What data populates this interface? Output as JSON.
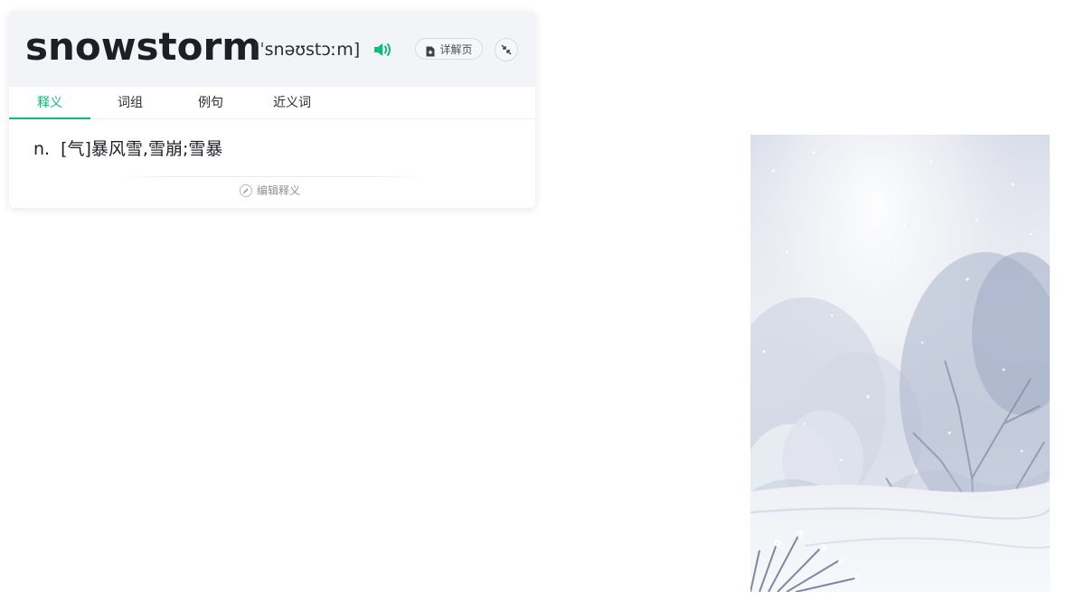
{
  "word": {
    "headword": "snowstorm",
    "phonetic": "[ˈsnəʊstɔːm]",
    "detail_button": "详解页"
  },
  "tabs": [
    {
      "label": "释义",
      "active": true
    },
    {
      "label": "词组",
      "active": false
    },
    {
      "label": "例句",
      "active": false
    },
    {
      "label": "近义词",
      "active": false
    }
  ],
  "definition": {
    "pos": "n.",
    "meaning": "[气]暴风雪,雪崩;雪暴"
  },
  "edit_link": "编辑释义",
  "colors": {
    "accent": "#17b978",
    "text": "#1d1f27",
    "header_bg": "#f3f4f7"
  },
  "icons": {
    "speaker": "speaker-icon",
    "detail": "document-plus-icon",
    "collapse": "collapse-arrows-icon",
    "edit": "pencil-icon"
  }
}
